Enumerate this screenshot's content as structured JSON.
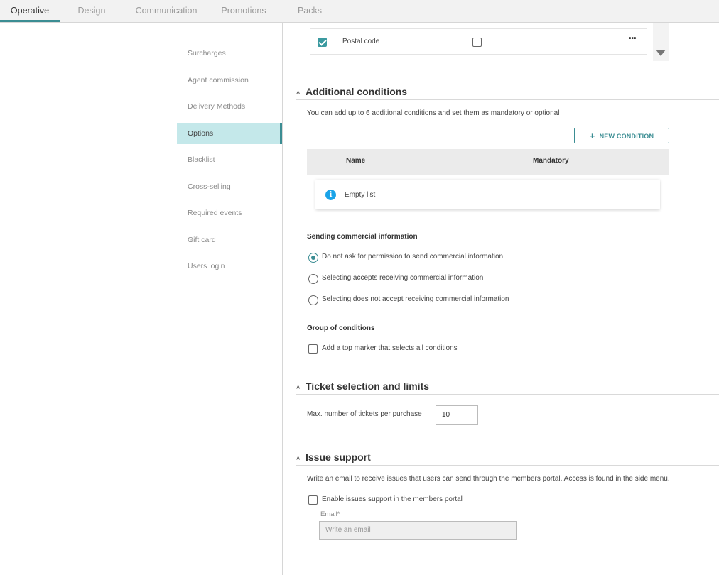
{
  "tabs": [
    {
      "label": "Operative",
      "active": true
    },
    {
      "label": "Design",
      "active": false
    },
    {
      "label": "Communication",
      "active": false
    },
    {
      "label": "Promotions",
      "active": false
    },
    {
      "label": "Packs",
      "active": false
    }
  ],
  "sidebar": {
    "items": [
      {
        "label": "Surcharges"
      },
      {
        "label": "Agent commission"
      },
      {
        "label": "Delivery Methods"
      },
      {
        "label": "Options",
        "active": true
      },
      {
        "label": "Blacklist"
      },
      {
        "label": "Cross-selling"
      },
      {
        "label": "Required events"
      },
      {
        "label": "Gift card"
      },
      {
        "label": "Users login"
      }
    ]
  },
  "top_row": {
    "label": "Postal code",
    "checked": true,
    "more": "•••"
  },
  "additional_conditions": {
    "title": "Additional conditions",
    "description": "You can add up to 6 additional conditions and set them as mandatory or optional",
    "new_button": "NEW CONDITION",
    "columns": [
      "Name",
      "Mandatory"
    ],
    "empty_text": "Empty list"
  },
  "commercial": {
    "title": "Sending commercial information",
    "options": [
      {
        "label": "Do not ask for permission to send commercial information",
        "selected": true
      },
      {
        "label": "Selecting accepts receiving commercial information",
        "selected": false
      },
      {
        "label": "Selecting does not accept receiving commercial information",
        "selected": false
      }
    ]
  },
  "group": {
    "title": "Group of conditions",
    "checkbox_label": "Add a top marker that selects all conditions"
  },
  "tickets": {
    "title": "Ticket selection and limits",
    "max_label": "Max. number of tickets per purchase",
    "max_value": "10"
  },
  "issue_support": {
    "title": "Issue support",
    "description": "Write an email to receive issues that users can send through the members portal. Access is found in the side menu.",
    "checkbox_label": "Enable issues support in the members portal",
    "email_label": "Email*",
    "email_placeholder": "Write an email"
  },
  "colors": {
    "accent": "#3b8d93",
    "active_nav": "#c4e8ea",
    "info": "#1aa3e8"
  }
}
